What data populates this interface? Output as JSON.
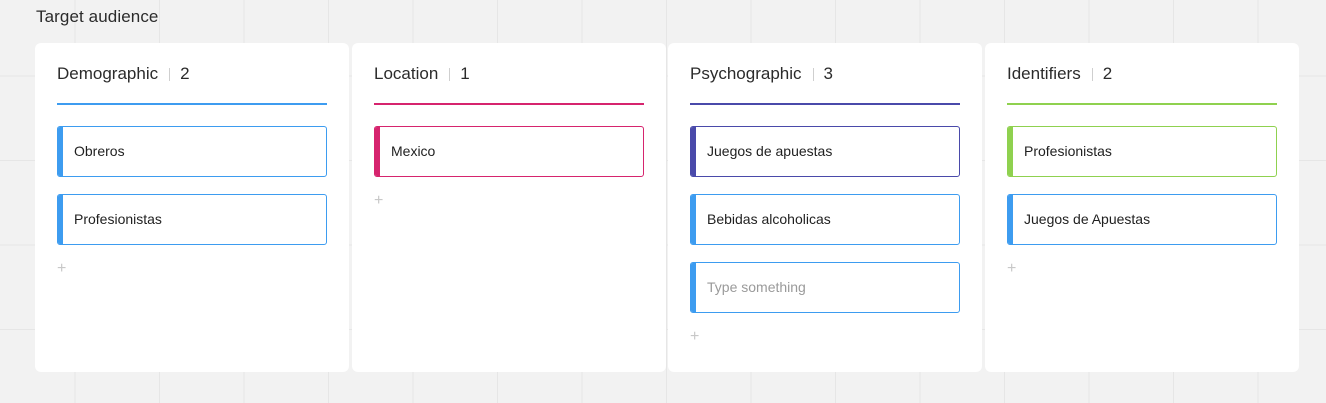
{
  "frame": {
    "title": "Target audience"
  },
  "colors": {
    "demographic": "#3d9cf0",
    "location": "#d6246e",
    "psychographic": "#4a4aaa",
    "identifiers": "#8fd14f"
  },
  "columns": [
    {
      "title": "Demographic",
      "count": "2",
      "cards": [
        {
          "text": "Obreros"
        },
        {
          "text": "Profesionistas"
        }
      ],
      "add_icon": "+"
    },
    {
      "title": "Location",
      "count": "1",
      "cards": [
        {
          "text": "Mexico"
        }
      ],
      "add_icon": "+"
    },
    {
      "title": "Psychographic",
      "count": "3",
      "cards": [
        {
          "text": "Juegos de apuestas"
        },
        {
          "text": "Bebidas alcoholicas"
        },
        {
          "placeholder": "Type something"
        }
      ],
      "add_icon": "+"
    },
    {
      "title": "Identifiers",
      "count": "2",
      "cards": [
        {
          "text": "Profesionistas"
        },
        {
          "text": "Juegos de Apuestas"
        }
      ],
      "add_icon": "+"
    }
  ]
}
